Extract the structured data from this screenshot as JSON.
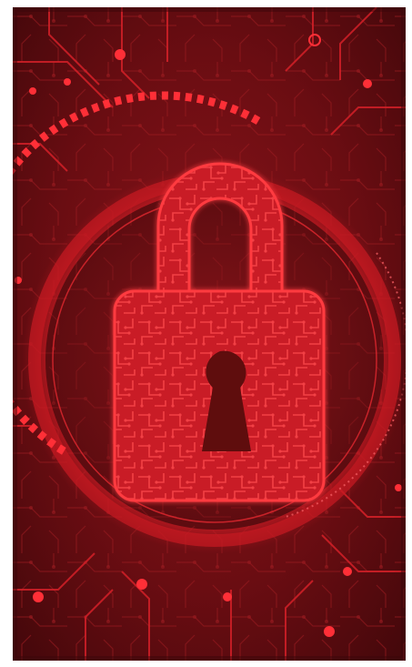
{
  "image": {
    "subject": "padlock-icon",
    "palette": {
      "background_dark": "#4a080c",
      "background_mid": "#7a1016",
      "accent_red": "#e3202b",
      "glow_red": "#ff3a3f"
    }
  }
}
